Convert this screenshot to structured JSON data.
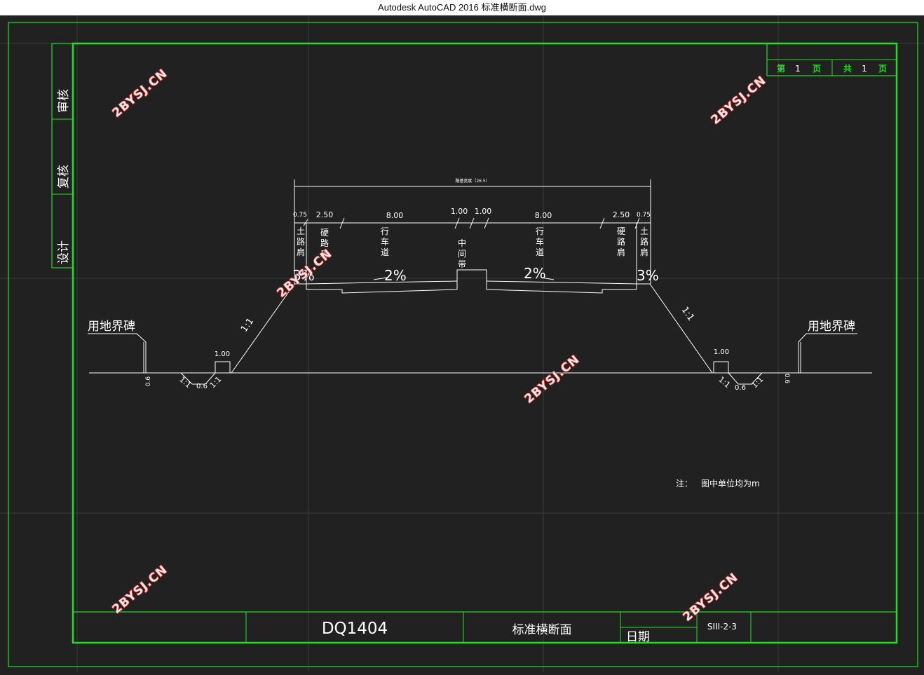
{
  "window": {
    "title": "Autodesk AutoCAD 2016     标准横断面.dwg"
  },
  "colors": {
    "background": "#212121",
    "frame": "#22dd22",
    "drawing": "#ffffff",
    "grid": "#3a3a3a",
    "watermark": "#d42020"
  },
  "sidebar": {
    "review": "审核",
    "recheck": "复核",
    "design": "设计"
  },
  "page_box": {
    "page_prefix": "第",
    "page_no": "1",
    "page_unit": "页",
    "total_prefix": "共",
    "total_no": "1",
    "total_unit": "页"
  },
  "title_block": {
    "project": "DQ1404",
    "drawing_name": "标准横断面",
    "date_label": "日期",
    "drawing_no": "SIII-2-3"
  },
  "note": {
    "label": "注：",
    "text": "图中单位均为m"
  },
  "drawing": {
    "overall_dim": "路基宽度（26.5）",
    "dims": [
      "0.75",
      "2.50",
      "8.00",
      "1.00",
      "1.00",
      "8.00",
      "2.50",
      "0.75"
    ],
    "zones": {
      "earth_shoulder": [
        "土",
        "路",
        "肩"
      ],
      "hard_shoulder": [
        "硬",
        "路",
        "肩"
      ],
      "carriageway": [
        "行",
        "车",
        "道"
      ],
      "median": [
        "中",
        "间",
        "带"
      ]
    },
    "slopes": {
      "shoulder": "3%",
      "lane": "2%"
    },
    "embankment_slope": "1:1",
    "ditch": {
      "top_width": "1.00",
      "bottom_width": "0.6",
      "depth": "0.6",
      "side_slope": "1:1"
    },
    "boundary_marker": "用地界碑"
  },
  "watermark": {
    "text": "2BYSJ.CN"
  }
}
